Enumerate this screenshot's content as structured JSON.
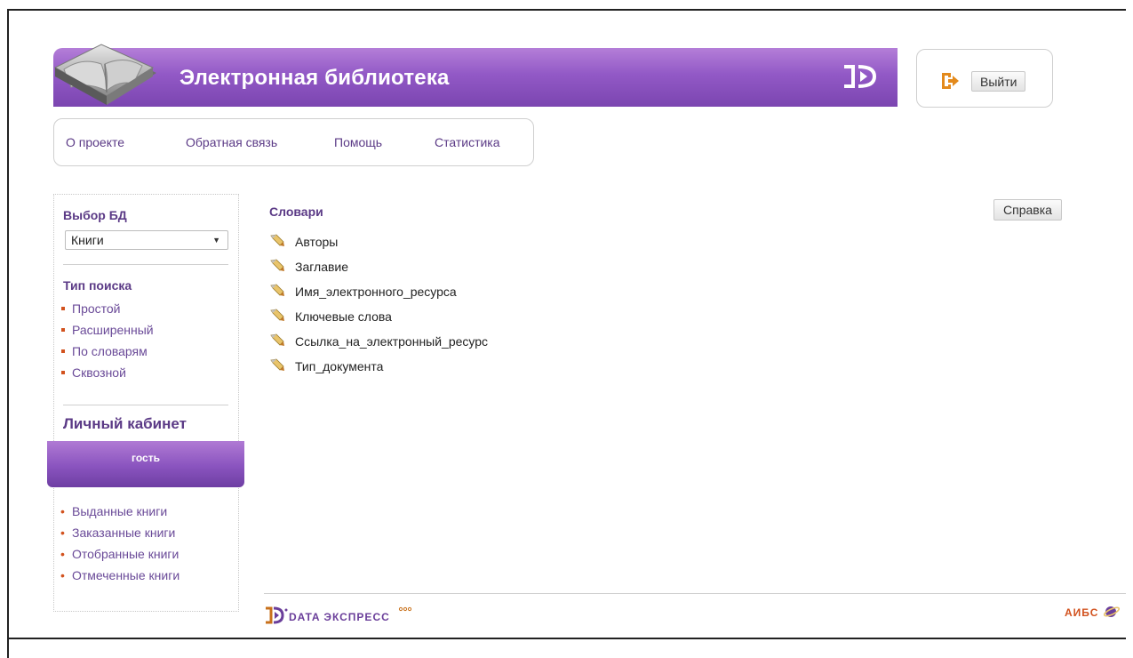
{
  "header": {
    "title": "Электронная библиотека",
    "logout_label": "Выйти"
  },
  "topnav": {
    "items": [
      "О проекте",
      "Обратная связь",
      "Помощь",
      "Статистика"
    ]
  },
  "sidebar": {
    "db_title": "Выбор БД",
    "db_selected": "Книги",
    "search_type_title": "Тип поиска",
    "search_types": [
      "Простой",
      "Расширенный",
      "По словарям",
      "Сквозной"
    ],
    "cabinet_title": "Личный кабинет",
    "user_label": "гость",
    "book_links": [
      "Выданные книги",
      "Заказанные книги",
      "Отобранные книги",
      "Отмеченные книги"
    ]
  },
  "main": {
    "dict_title": "Словари",
    "help_label": "Справка",
    "dictionaries": [
      "Авторы",
      "Заглавие",
      "Имя_электронного_ресурса",
      "Ключевые слова",
      "Ссылка_на_электронный_ресурс",
      "Тип_документа"
    ]
  },
  "footer": {
    "company_logo": "DATA ЭКСПРЕСС",
    "aibs_logo": "АИБС"
  },
  "colors": {
    "accent": "#8a54bf",
    "link": "#5b3a86",
    "bullet": "#d2521e"
  }
}
